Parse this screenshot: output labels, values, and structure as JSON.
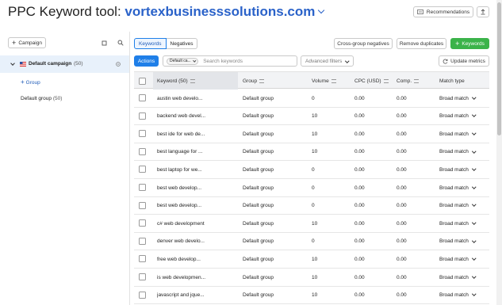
{
  "header": {
    "title_prefix": "PPC Keyword tool:",
    "domain": "vortexbusinesssolutions.com",
    "recommendations_label": "Recommendations"
  },
  "left_panel": {
    "add_campaign_label": "Campaign",
    "campaign_name": "Default campaign",
    "campaign_count": "(50)",
    "add_group_label": "Group",
    "group_name": "Default group",
    "group_count": "(50)"
  },
  "tabs": [
    {
      "label": "Keywords",
      "active": true
    },
    {
      "label": "Negatives",
      "active": false
    }
  ],
  "actions": {
    "cross_group_label": "Cross-group negatives",
    "remove_duplicates_label": "Remove duplicates",
    "add_keywords_label": "Keywords",
    "actions_label": "Actions",
    "filter_chip": "Default ca...",
    "search_placeholder": "Search keywords",
    "advanced_filters_label": "Advanced filters",
    "update_metrics_label": "Update metrics"
  },
  "table": {
    "columns": [
      "Keyword (50)",
      "Group",
      "Volume",
      "CPC (USD)",
      "Comp.",
      "Match type"
    ],
    "rows": [
      {
        "keyword": "austin web develo...",
        "group": "Default group",
        "volume": "0",
        "cpc": "0.00",
        "comp": "0.00",
        "match": "Broad match"
      },
      {
        "keyword": "backend web devel...",
        "group": "Default group",
        "volume": "10",
        "cpc": "0.00",
        "comp": "0.00",
        "match": "Broad match"
      },
      {
        "keyword": "best ide for web de...",
        "group": "Default group",
        "volume": "10",
        "cpc": "0.00",
        "comp": "0.00",
        "match": "Broad match"
      },
      {
        "keyword": "best language for ...",
        "group": "Default group",
        "volume": "10",
        "cpc": "0.00",
        "comp": "0.00",
        "match": "Broad match"
      },
      {
        "keyword": "best laptop for we...",
        "group": "Default group",
        "volume": "0",
        "cpc": "0.00",
        "comp": "0.00",
        "match": "Broad match"
      },
      {
        "keyword": "best web develop...",
        "group": "Default group",
        "volume": "0",
        "cpc": "0.00",
        "comp": "0.00",
        "match": "Broad match"
      },
      {
        "keyword": "best web develop...",
        "group": "Default group",
        "volume": "0",
        "cpc": "0.00",
        "comp": "0.00",
        "match": "Broad match"
      },
      {
        "keyword": "c# web development",
        "group": "Default group",
        "volume": "10",
        "cpc": "0.00",
        "comp": "0.00",
        "match": "Broad match"
      },
      {
        "keyword": "denver web develo...",
        "group": "Default group",
        "volume": "0",
        "cpc": "0.00",
        "comp": "0.00",
        "match": "Broad match"
      },
      {
        "keyword": "free web develop...",
        "group": "Default group",
        "volume": "10",
        "cpc": "0.00",
        "comp": "0.00",
        "match": "Broad match"
      },
      {
        "keyword": "is web developmen...",
        "group": "Default group",
        "volume": "10",
        "cpc": "0.00",
        "comp": "0.00",
        "match": "Broad match"
      },
      {
        "keyword": "javascript and jque...",
        "group": "Default group",
        "volume": "10",
        "cpc": "0.00",
        "comp": "0.00",
        "match": "Broad match"
      }
    ]
  },
  "colors": {
    "brand_blue": "#2a62c9",
    "accent_green": "#3bb34a",
    "selected_row": "#e8f1fb"
  }
}
